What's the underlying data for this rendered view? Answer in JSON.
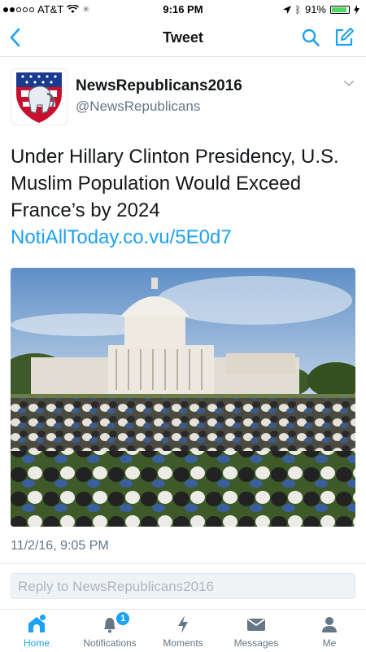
{
  "status_bar": {
    "carrier": "AT&T",
    "time": "9:16 PM",
    "battery": "91%",
    "battery_level": 0.91,
    "signal_bars": 2
  },
  "nav": {
    "title": "Tweet",
    "icons": [
      "back-chevron-icon",
      "search-icon",
      "compose-icon"
    ]
  },
  "tweet": {
    "display_name": "NewsRepublicans2016",
    "handle": "@NewsRepublicans",
    "text": "Under Hillary Clinton Presidency, U.S. Muslim Population Would Exceed France’s by 2024 ",
    "link": "NotiAllToday.co.vu/5E0d7",
    "timestamp": "11/2/16, 9:05 PM"
  },
  "reply": {
    "placeholder": "Reply to NewsRepublicans2016"
  },
  "tabbar": {
    "items": [
      {
        "label": "Home",
        "icon": "home-icon",
        "active": true
      },
      {
        "label": "Notifications",
        "icon": "bell-icon",
        "badge": "1"
      },
      {
        "label": "Moments",
        "icon": "lightning-icon"
      },
      {
        "label": "Messages",
        "icon": "envelope-icon"
      },
      {
        "label": "Me",
        "icon": "person-icon"
      }
    ]
  },
  "colors": {
    "accent": "#1da1f2",
    "text": "#14171a",
    "muted": "#657786"
  }
}
